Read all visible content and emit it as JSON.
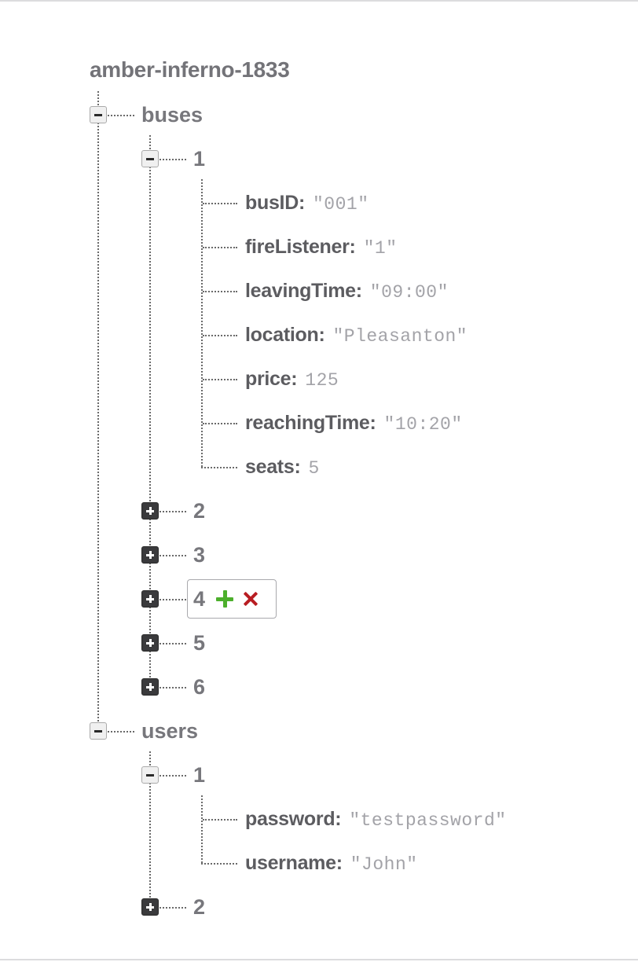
{
  "database": {
    "name": "amber-inferno-1833"
  },
  "buses": {
    "key": "buses",
    "expanded_item": {
      "key": "1",
      "fields": [
        {
          "key": "busID:",
          "value": "\"001\""
        },
        {
          "key": "fireListener:",
          "value": "\"1\""
        },
        {
          "key": "leavingTime:",
          "value": "\"09:00\""
        },
        {
          "key": "location:",
          "value": "\"Pleasanton\""
        },
        {
          "key": "price:",
          "value": "125"
        },
        {
          "key": "reachingTime:",
          "value": "\"10:20\""
        },
        {
          "key": "seats:",
          "value": "5"
        }
      ]
    },
    "collapsed_items": [
      "2",
      "3",
      "4",
      "5",
      "6"
    ]
  },
  "users": {
    "key": "users",
    "expanded_item": {
      "key": "1",
      "fields": [
        {
          "key": "password:",
          "value": "\"testpassword\""
        },
        {
          "key": "username:",
          "value": "\"John\""
        }
      ]
    },
    "collapsed_items": [
      "2"
    ]
  },
  "actions": {
    "add_icon": "plus-icon",
    "remove_icon": "x-icon",
    "add_color": "#4caf2c",
    "remove_color": "#b81d22"
  }
}
